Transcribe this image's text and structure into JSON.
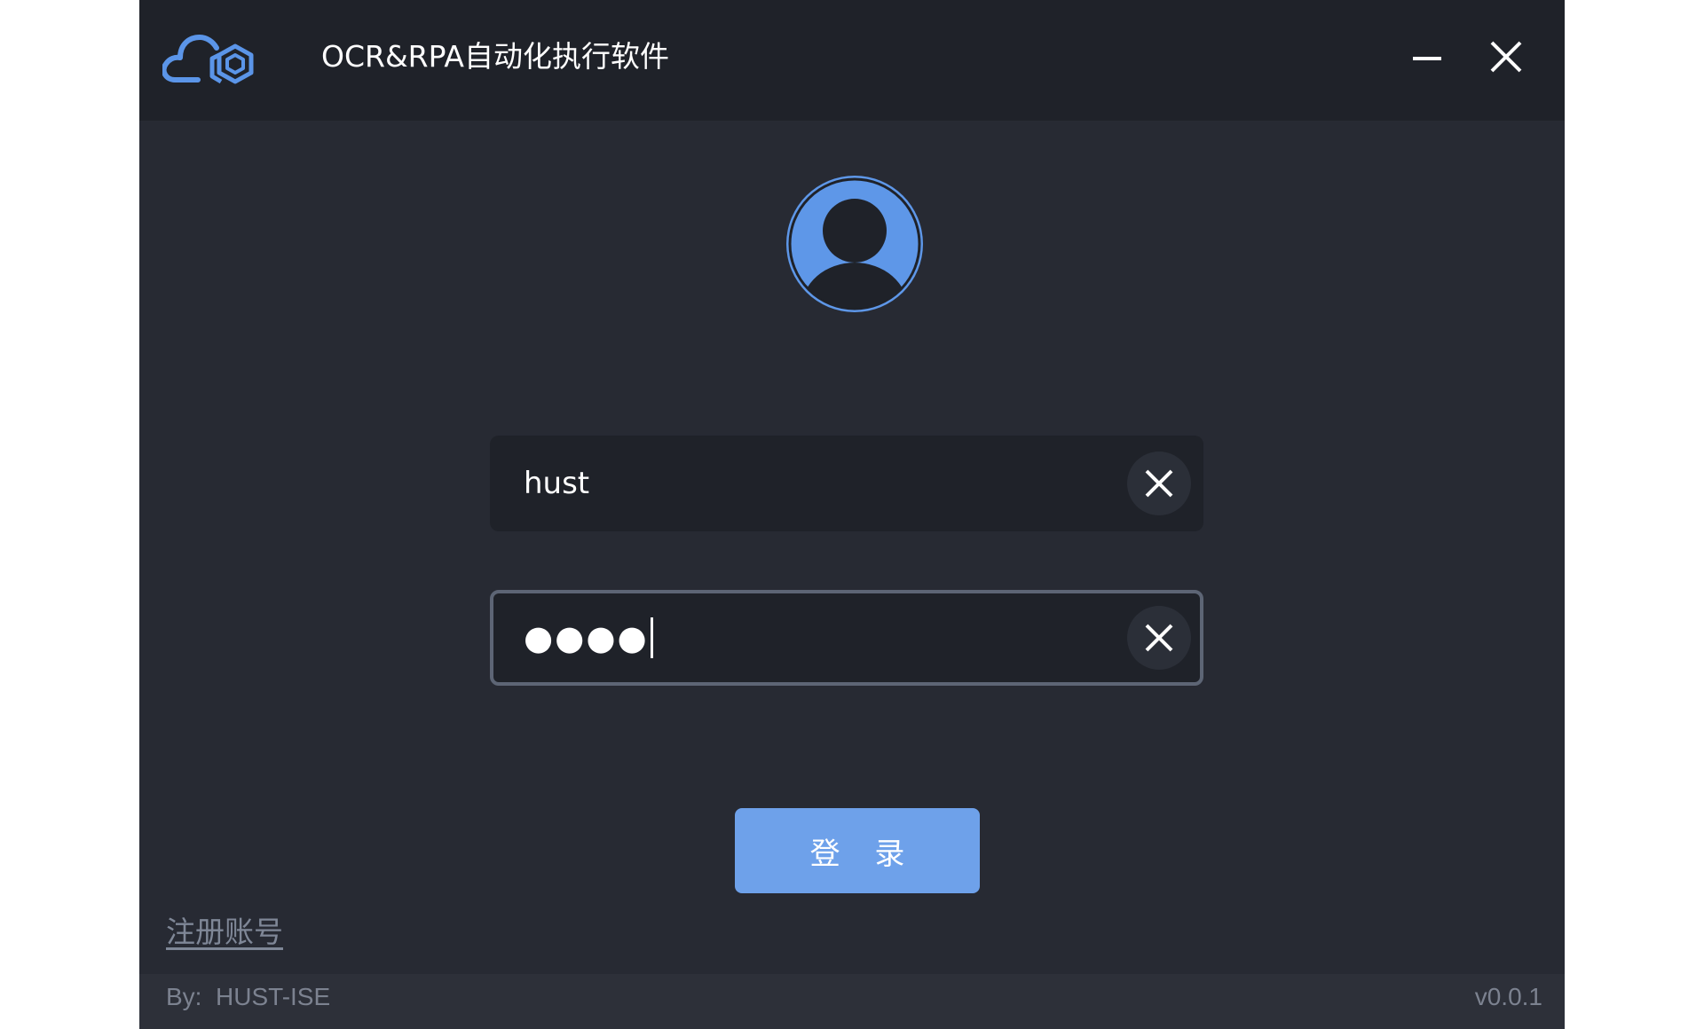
{
  "window": {
    "title": "OCR&RPA自动化执行软件",
    "logo_icon": "cloud-hexagon-logo-icon",
    "minimize_icon": "minimize-icon",
    "close_icon": "close-icon"
  },
  "login": {
    "avatar_icon": "user-avatar-icon",
    "username": {
      "value": "hust",
      "clear_icon": "clear-icon"
    },
    "password": {
      "masked_value": "●●●●",
      "clear_icon": "clear-icon"
    },
    "login_button_label": "登 录",
    "register_link_label": "注册账号"
  },
  "footer": {
    "by_text": "By:  HUST-ISE",
    "version": "v0.0.1"
  },
  "colors": {
    "window_bg": "#272a33",
    "titlebar_bg": "#1f2229",
    "accent_blue": "#6ea1ea",
    "input_bg": "#1f2229",
    "muted_text": "#7c8290"
  }
}
